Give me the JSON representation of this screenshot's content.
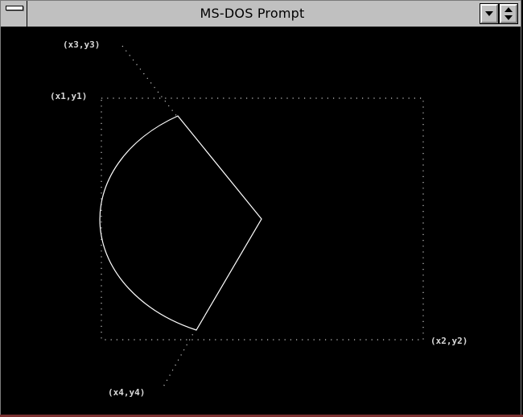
{
  "window": {
    "title": "MS-DOS Prompt",
    "controls": {
      "system_menu_icon": "system-menu-icon",
      "minimize_icon": "down-arrow-icon",
      "restore_icon": "up-down-arrow-icon"
    }
  },
  "drawing": {
    "labels": {
      "p3": "(x3,y3)",
      "p1": "(x1,y1)",
      "p2": "(x2,y2)",
      "p4": "(x4,y4)"
    },
    "colors": {
      "background": "#000000",
      "shape": "#ffffff",
      "dotted_guides": "#c8c8c8",
      "labels": "#d8d8d8"
    }
  }
}
